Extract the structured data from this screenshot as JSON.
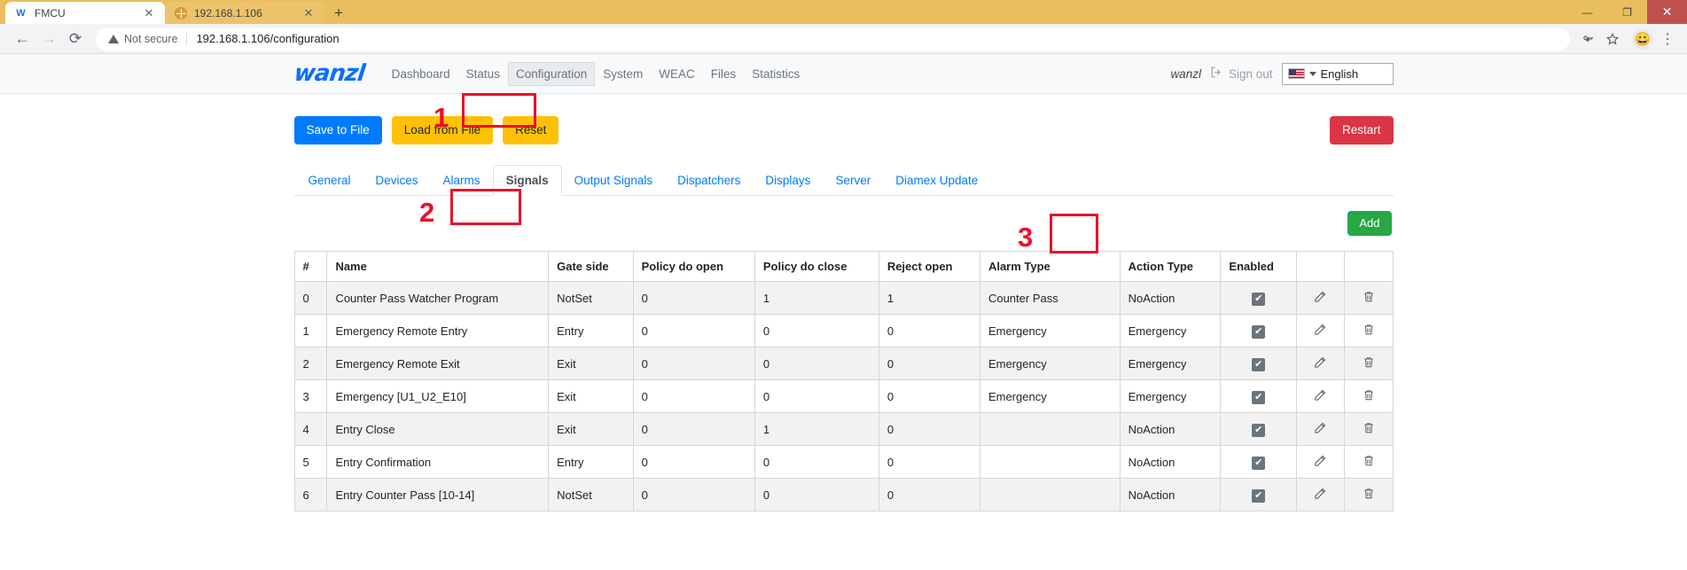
{
  "browser": {
    "tabs": [
      {
        "title": "FMCU",
        "favicon": "wanzl-w-icon",
        "active": true
      },
      {
        "title": "192.168.1.106",
        "favicon": "globe-icon",
        "active": false
      }
    ],
    "new_tab_label": "+",
    "window_controls": {
      "minimize": "—",
      "maximize": "❐",
      "close": "✕"
    },
    "omnibox": {
      "security_label": "Not secure",
      "url": "192.168.1.106/configuration",
      "key_icon": "key-icon",
      "star_icon": "star-icon",
      "profile_icon": "😀",
      "menu_icon": "⋮"
    },
    "nav": {
      "back": "←",
      "forward": "→",
      "reload": "⟳"
    }
  },
  "app": {
    "brand": "wanzl",
    "nav_items": [
      {
        "label": "Dashboard",
        "active": false
      },
      {
        "label": "Status",
        "active": false
      },
      {
        "label": "Configuration",
        "active": true
      },
      {
        "label": "System",
        "active": false
      },
      {
        "label": "WEAC",
        "active": false
      },
      {
        "label": "Files",
        "active": false
      },
      {
        "label": "Statistics",
        "active": false
      }
    ],
    "user": "wanzl",
    "sign_out": "Sign out",
    "language": "English"
  },
  "toolbar": {
    "save_to_file": "Save to File",
    "load_from_file": "Load from File",
    "reset": "Reset",
    "restart": "Restart"
  },
  "tabs": [
    {
      "label": "General",
      "active": false
    },
    {
      "label": "Devices",
      "active": false
    },
    {
      "label": "Alarms",
      "active": false
    },
    {
      "label": "Signals",
      "active": true
    },
    {
      "label": "Output Signals",
      "active": false
    },
    {
      "label": "Dispatchers",
      "active": false
    },
    {
      "label": "Displays",
      "active": false
    },
    {
      "label": "Server",
      "active": false
    },
    {
      "label": "Diamex Update",
      "active": false
    }
  ],
  "add_button": "Add",
  "table": {
    "columns": [
      "#",
      "Name",
      "Gate side",
      "Policy do open",
      "Policy do close",
      "Reject open",
      "Alarm Type",
      "Action Type",
      "Enabled",
      "",
      ""
    ],
    "rows": [
      {
        "num": "0",
        "name": "Counter Pass Watcher Program",
        "gate_side": "NotSet",
        "policy_do_open": "0",
        "policy_do_close": "1",
        "reject_open": "1",
        "alarm_type": "Counter Pass",
        "action_type": "NoAction",
        "enabled": true
      },
      {
        "num": "1",
        "name": "Emergency Remote Entry",
        "gate_side": "Entry",
        "policy_do_open": "0",
        "policy_do_close": "0",
        "reject_open": "0",
        "alarm_type": "Emergency",
        "action_type": "Emergency",
        "enabled": true
      },
      {
        "num": "2",
        "name": "Emergency Remote Exit",
        "gate_side": "Exit",
        "policy_do_open": "0",
        "policy_do_close": "0",
        "reject_open": "0",
        "alarm_type": "Emergency",
        "action_type": "Emergency",
        "enabled": true
      },
      {
        "num": "3",
        "name": "Emergency [U1_U2_E10]",
        "gate_side": "Exit",
        "policy_do_open": "0",
        "policy_do_close": "0",
        "reject_open": "0",
        "alarm_type": "Emergency",
        "action_type": "Emergency",
        "enabled": true
      },
      {
        "num": "4",
        "name": "Entry Close",
        "gate_side": "Exit",
        "policy_do_open": "0",
        "policy_do_close": "1",
        "reject_open": "0",
        "alarm_type": "",
        "action_type": "NoAction",
        "enabled": true
      },
      {
        "num": "5",
        "name": "Entry Confirmation",
        "gate_side": "Entry",
        "policy_do_open": "0",
        "policy_do_close": "0",
        "reject_open": "0",
        "alarm_type": "",
        "action_type": "NoAction",
        "enabled": true
      },
      {
        "num": "6",
        "name": "Entry Counter Pass [10-14]",
        "gate_side": "NotSet",
        "policy_do_open": "0",
        "policy_do_close": "0",
        "reject_open": "0",
        "alarm_type": "",
        "action_type": "NoAction",
        "enabled": true
      }
    ],
    "edit_icon": "edit-icon",
    "delete_icon": "trash-icon",
    "checked_glyph": "✔"
  },
  "annotations": [
    {
      "number": "1"
    },
    {
      "number": "2"
    },
    {
      "number": "3"
    }
  ],
  "colors": {
    "accent_blue": "#007BFF",
    "warning_yellow": "#FFC107",
    "danger_red": "#DC3545",
    "success_green": "#28A745",
    "annotation_red": "#E8112D",
    "chrome_tab_bg": "#E9BE5E"
  }
}
